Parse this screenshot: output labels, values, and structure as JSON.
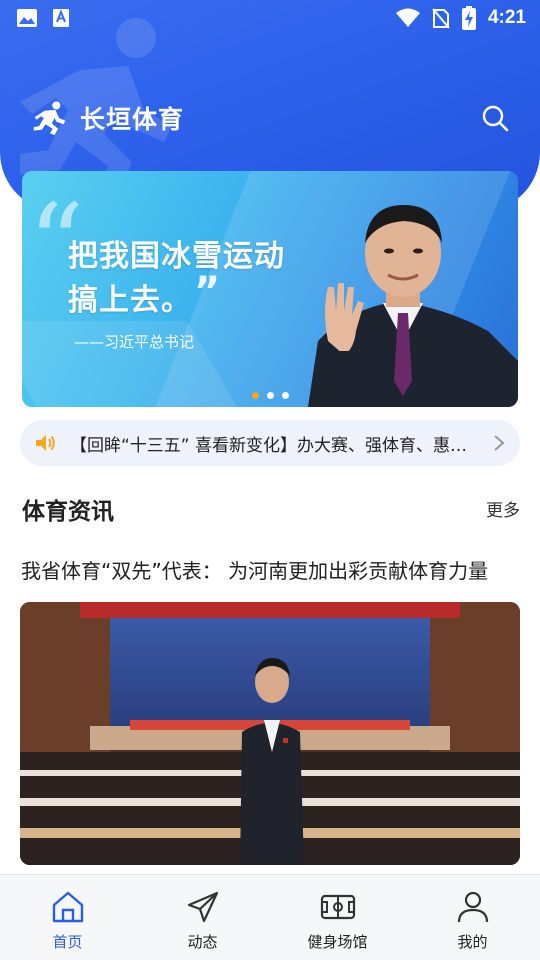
{
  "status_bar": {
    "time": "4:21",
    "icons": [
      "image-icon",
      "a11y-font-icon",
      "wifi-icon",
      "no-sim-icon",
      "battery-charging-icon"
    ]
  },
  "header": {
    "app_title": "长垣体育",
    "logo_icon": "runner-icon",
    "search_icon": "search-icon",
    "brand_color": "#2a5ee8"
  },
  "banner": {
    "line1": "把我国冰雪运动",
    "line2": "搞上去。",
    "caption": "——习近平总书记",
    "slides_total": 3,
    "active_slide": 1
  },
  "ticker": {
    "icon": "speaker-icon",
    "text": "【回眸“十三五” 喜看新变化】办大赛、强体育、惠民..."
  },
  "section": {
    "title": "体育资讯",
    "more": "更多"
  },
  "news": {
    "headline": "我省体育“双先”代表： 为河南更加出彩贡献体育力量"
  },
  "bottom_nav": {
    "items": [
      {
        "label": "首页",
        "icon": "home-icon",
        "active": true
      },
      {
        "label": "动态",
        "icon": "paper-plane-icon",
        "active": false
      },
      {
        "label": "健身场馆",
        "icon": "stadium-icon",
        "active": false
      },
      {
        "label": "我的",
        "icon": "user-icon",
        "active": false
      }
    ]
  }
}
